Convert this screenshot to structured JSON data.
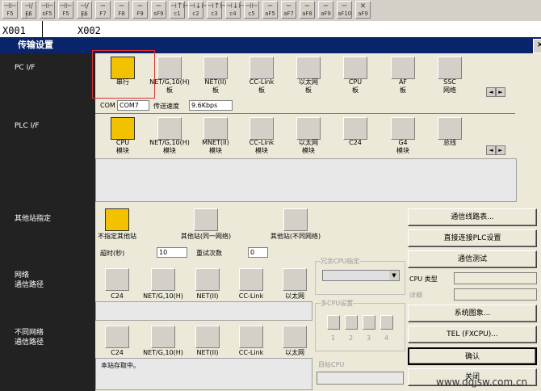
{
  "toolbar": {
    "fkeys": [
      {
        "glyph": "⊣⊢",
        "label": "F5"
      },
      {
        "glyph": "⊣/⊢",
        "label": "F6"
      },
      {
        "glyph": "⊣⊢",
        "label": "sF5"
      },
      {
        "glyph": "⊣⊢",
        "label": "F5"
      },
      {
        "glyph": "⊣/⊢",
        "label": "F6"
      },
      {
        "glyph": "─",
        "label": "F7"
      },
      {
        "glyph": "─",
        "label": "F8"
      },
      {
        "glyph": "─",
        "label": "F9"
      },
      {
        "glyph": "─",
        "label": "sF9"
      },
      {
        "glyph": "⊣↑⊢",
        "label": "c1"
      },
      {
        "glyph": "⊣↓⊢",
        "label": "c2"
      },
      {
        "glyph": "⊣↑⊢",
        "label": "c3"
      },
      {
        "glyph": "⊣↓⊢",
        "label": "c4"
      },
      {
        "glyph": "⊣⊢",
        "label": "c5"
      },
      {
        "glyph": "─",
        "label": "aF5"
      },
      {
        "glyph": "─",
        "label": "aF7"
      },
      {
        "glyph": "─",
        "label": "aF8"
      },
      {
        "glyph": "─",
        "label": "aF9"
      },
      {
        "glyph": "─",
        "label": "aF10"
      },
      {
        "glyph": "✕",
        "label": "aF9"
      }
    ]
  },
  "ladder": {
    "left_label": "X001",
    "right_label": "X002"
  },
  "dialog": {
    "title": "传输设置",
    "close": "×",
    "sections": {
      "pc_if": "PC I/F",
      "plc_if": "PLC I/F",
      "other_station": "其他站指定",
      "network_route": "网络\n通信路径",
      "diff_network": "不同网络\n通信路径"
    },
    "pc_items": [
      "串行",
      "NET/G,10(H)\n板",
      "NET(II)\n板",
      "CC-Link\n板",
      "以太网\n板",
      "CPU\n板",
      "AF\n板",
      "SSC\n网络"
    ],
    "com_label": "COM",
    "com_value": "COM7",
    "speed_label": "传送速度",
    "speed_value": "9.6Kbps",
    "plc_items": [
      "CPU\n模块",
      "NET/G,10(H)\n模块",
      "MNET(II)\n模块",
      "CC-Link\n模块",
      "以太网\n模块",
      "C24",
      "G4\n模块",
      "总线"
    ],
    "other_items": [
      "不指定其他站",
      "其他站(同一网络)",
      "其他站(不同网络)"
    ],
    "timeout_label": "超时(秒)",
    "timeout_value": "10",
    "retry_label": "重试次数",
    "retry_value": "0",
    "route_items": [
      "C24",
      "NET/G,10(H)",
      "NET(II)",
      "CC-Link",
      "以太网"
    ],
    "diff_items": [
      "C24",
      "NET/G,10(H)",
      "NET(II)",
      "CC-Link",
      "以太网"
    ],
    "status_text": "本站存取中。",
    "multi_cpu_spec": "冗余CPU指定",
    "multi_cpu_set": "多CPU设置",
    "cpu_nums": [
      "1",
      "2",
      "3",
      "4"
    ],
    "target_cpu": "目标CPU",
    "buttons": {
      "route_table": "通信线路表...",
      "direct_plc": "直接连接PLC设置",
      "comm_test": "通信测试",
      "system_image": "系统图象...",
      "tel": "TEL (FXCPU)...",
      "ok": "确认",
      "close": "关闭"
    },
    "cpu_type_label": "CPU 类型",
    "detail_label": "详细"
  },
  "watermark": "www.dqjsw.com.cn"
}
